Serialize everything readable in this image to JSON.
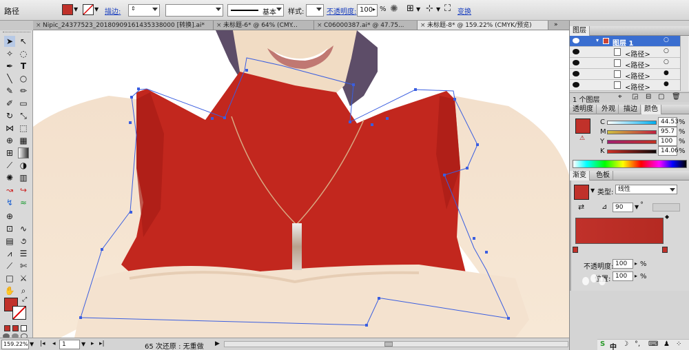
{
  "control_bar": {
    "object_type": "路径",
    "stroke_label": "描边:",
    "stroke_style_label": "基本",
    "style_label": "样式:",
    "opacity_label": "不透明度:",
    "opacity_value": "100",
    "opacity_unit": "%",
    "transform_label": "变换",
    "fill_color": "#c0312a"
  },
  "tabs": [
    {
      "label": "Nipic_24377523_20180909161435338000 [转换].ai*"
    },
    {
      "label": "未标题-6* @ 64% (CMY..."
    },
    {
      "label": "C06000387.ai* @ 47.75..."
    },
    {
      "label": "未标题-8* @ 159.22% (CMYK/预览)"
    }
  ],
  "status": {
    "zoom": "159.22%",
    "page": "1",
    "undo_text": "65 次还原 : 无重做"
  },
  "layers": {
    "title": "图层",
    "rows": [
      {
        "label": "图层 1"
      },
      {
        "label": "<路径>"
      },
      {
        "label": "<路径>"
      },
      {
        "label": "<路径>"
      },
      {
        "label": "<路径>"
      }
    ],
    "count_text": "1 个图层"
  },
  "color_panel": {
    "tabs": [
      "透明度",
      "外观",
      "描边",
      "颜色"
    ],
    "channels": [
      {
        "letter": "C",
        "value": "44.53",
        "unit": "%"
      },
      {
        "letter": "M",
        "value": "95.7",
        "unit": "%"
      },
      {
        "letter": "Y",
        "value": "100",
        "unit": "%"
      },
      {
        "letter": "K",
        "value": "14.06",
        "unit": "%"
      }
    ]
  },
  "gradient_panel": {
    "tabs": [
      "渐变",
      "色板"
    ],
    "type_label": "类型:",
    "type_value": "线性",
    "angle_value": "90",
    "angle_unit": "°",
    "opacity_label": "不透明度:",
    "opacity_value": "100",
    "opacity_unit": "%",
    "position_label": "位置:",
    "position_value": "100",
    "position_unit": "%"
  },
  "taskbar_text": "中"
}
